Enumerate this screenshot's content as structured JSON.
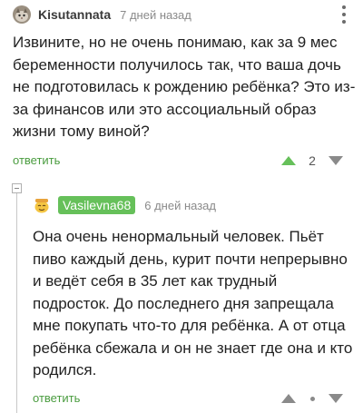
{
  "comments": [
    {
      "username": "Kisutannata",
      "time": "7 дней назад",
      "text": "Извините, но не очень понимаю, как за 9 мес беременности получилось так, что ваша дочь не подготовилась к рождению ребёнка? Это из-за финансов или это ассоциальный образ жизни тому виной?",
      "reply_label": "ответить",
      "score": "2",
      "avatar_icon": "cat-avatar-icon"
    },
    {
      "username": "Vasilevna68",
      "time": "6 дней назад",
      "text": "Она очень ненормальный человек. Пьёт пиво каждый день, курит почти непрерывно и ведёт себя в 35 лет как трудный подросток. До последнего дня запрещала мне покупать что-то для ребёнка. А от отца ребёнка сбежала и он не знает где она и кто родился.",
      "reply_label": "ответить",
      "avatar_icon": "emoji-avatar-icon"
    }
  ],
  "colors": {
    "accent": "#4a9c3f",
    "upvote_active": "#66c05a",
    "author_badge": "#66c05a",
    "muted": "#8a8a8a"
  }
}
